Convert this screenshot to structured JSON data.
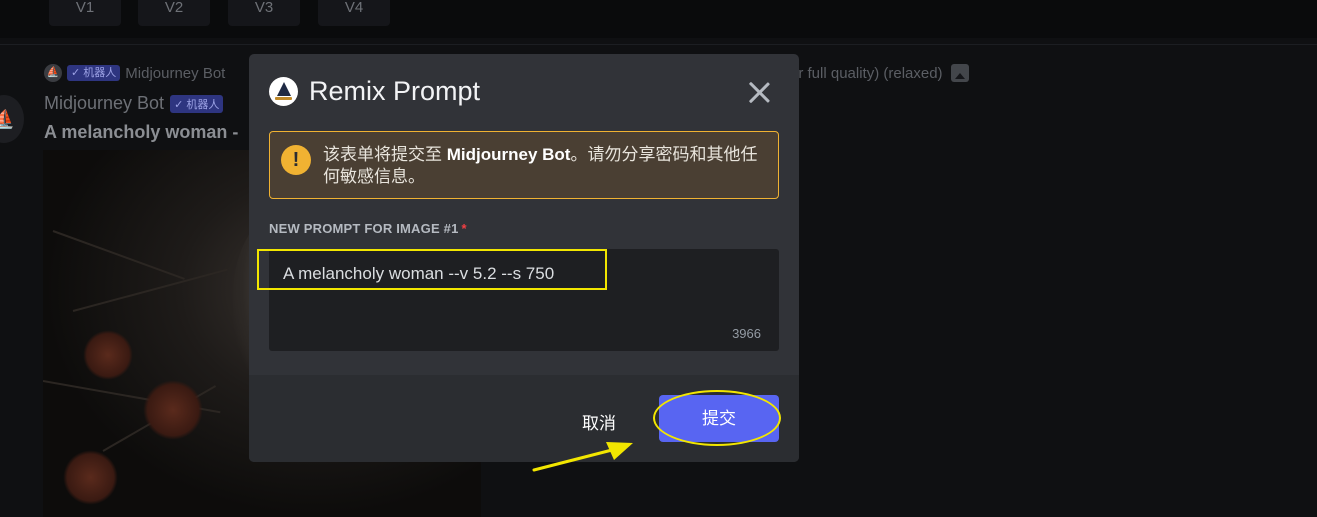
{
  "variation_buttons": [
    "V1",
    "V2",
    "V3",
    "V4"
  ],
  "reply": {
    "bot_tag": "机器人",
    "author": "Midjourney Bot"
  },
  "reply_tail": "or full quality) (relaxed)",
  "message": {
    "author": "Midjourney Bot",
    "bot_tag": "机器人",
    "text": "A melancholy woman -"
  },
  "modal": {
    "title": "Remix Prompt",
    "warning_prefix": "该表单将提交至 ",
    "warning_bot": "Midjourney Bot",
    "warning_suffix": "。请勿分享密码和其他任何敏感信息。",
    "field_label": "NEW PROMPT FOR IMAGE #1",
    "required_mark": "*",
    "prompt_value": "A melancholy woman --v 5.2 --s 750",
    "char_count": "3966",
    "cancel_label": "取消",
    "submit_label": "提交"
  },
  "colors": {
    "accent": "#5865f2",
    "warning": "#f0b232",
    "annotation": "#f2e600",
    "required": "#f23f43"
  },
  "icons": [
    "bot-logo-icon",
    "close-icon",
    "warning-icon",
    "image-icon",
    "checkmark-icon",
    "annotation-arrow-icon"
  ]
}
